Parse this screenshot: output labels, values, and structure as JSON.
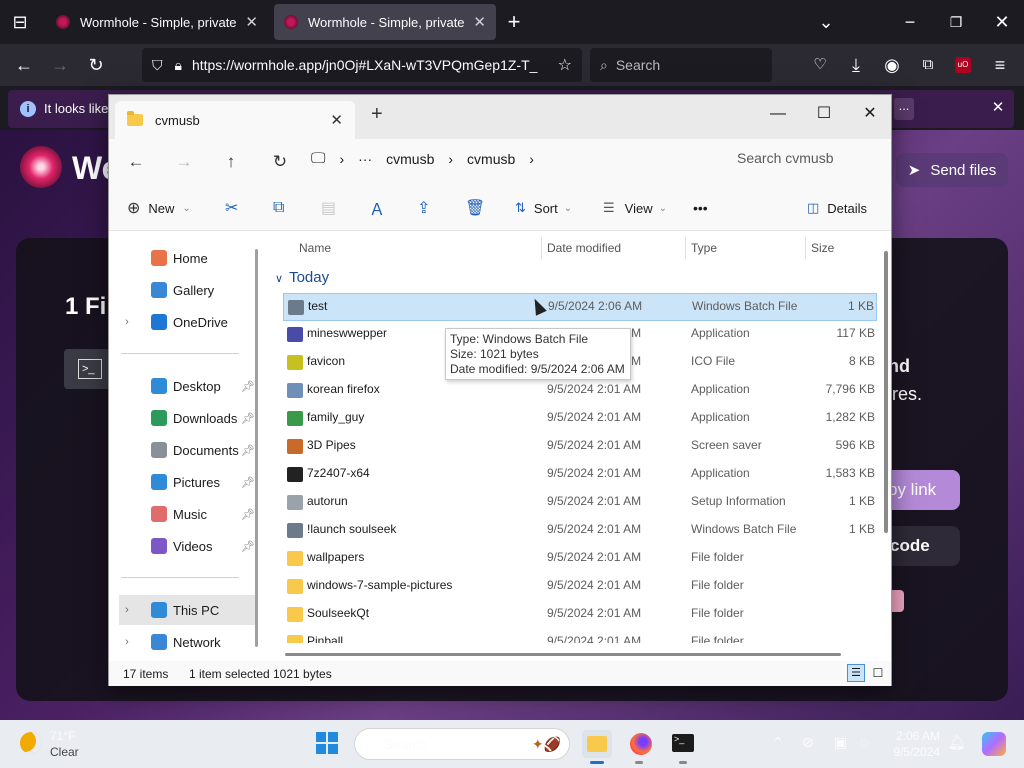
{
  "browser": {
    "tabs": [
      {
        "title": "Wormhole - Simple, private file",
        "active": false
      },
      {
        "title": "Wormhole - Simple, private file",
        "active": true
      }
    ],
    "url": "https://wormhole.app/jn0Oj#LXaN-wT3VPQmGep1Z-T_",
    "search_placeholder": "Search",
    "notification": "It looks like",
    "notification_more": "..."
  },
  "wormhole": {
    "brand": "We",
    "send_files": "Send files",
    "heading": "1 Fi",
    "right_line1": "nd",
    "right_line2": "ires.",
    "copy_link": "py link",
    "qr_code": "code"
  },
  "explorer": {
    "tab_title": "cvmusb",
    "new_tab": "+",
    "breadcrumb": [
      "cvmusb",
      "cvmusb"
    ],
    "more_crumbs": "···",
    "search_placeholder": "Search cvmusb",
    "commands": {
      "new": "New",
      "sort": "Sort",
      "view": "View",
      "more": "•••",
      "details": "Details"
    },
    "sidebar": [
      {
        "label": "Home",
        "color": "#e8734a",
        "pinned": false,
        "chevron": false
      },
      {
        "label": "Gallery",
        "color": "#3a87d6",
        "pinned": false,
        "chevron": false
      },
      {
        "label": "OneDrive",
        "color": "#1f77d4",
        "pinned": false,
        "chevron": true
      },
      {
        "label": "Desktop",
        "color": "#2f8ad8",
        "pinned": true,
        "chevron": false
      },
      {
        "label": "Downloads",
        "color": "#2c9a5b",
        "pinned": true,
        "chevron": false
      },
      {
        "label": "Documents",
        "color": "#8a8f99",
        "pinned": true,
        "chevron": false
      },
      {
        "label": "Pictures",
        "color": "#2f8ad8",
        "pinned": true,
        "chevron": false
      },
      {
        "label": "Music",
        "color": "#e06d6d",
        "pinned": true,
        "chevron": false
      },
      {
        "label": "Videos",
        "color": "#7d57c7",
        "pinned": true,
        "chevron": false
      },
      {
        "label": "This PC",
        "color": "#2f8ad8",
        "pinned": false,
        "chevron": true
      },
      {
        "label": "Network",
        "color": "#3a87d6",
        "pinned": false,
        "chevron": true
      }
    ],
    "columns": [
      "Name",
      "Date modified",
      "Type",
      "Size"
    ],
    "group": "Today",
    "files": [
      {
        "name": "test",
        "date": "9/5/2024 2:06 AM",
        "type": "Windows Batch File",
        "size": "1 KB",
        "icon": "#6b7b8c"
      },
      {
        "name": "mineswwepper",
        "date": "9/5/2024 2:01 AM",
        "type": "Application",
        "size": "117 KB",
        "icon": "#4a4aa8"
      },
      {
        "name": "favicon",
        "date": "9/5/2024 2:01 AM",
        "type": "ICO File",
        "size": "8 KB",
        "icon": "#c8c020"
      },
      {
        "name": "korean firefox",
        "date": "9/5/2024 2:01 AM",
        "type": "Application",
        "size": "7,796 KB",
        "icon": "#6f8fb8"
      },
      {
        "name": "family_guy",
        "date": "9/5/2024 2:01 AM",
        "type": "Application",
        "size": "1,282 KB",
        "icon": "#3a9a4a"
      },
      {
        "name": "3D Pipes",
        "date": "9/5/2024 2:01 AM",
        "type": "Screen saver",
        "size": "596 KB",
        "icon": "#c86a2a"
      },
      {
        "name": "7z2407-x64",
        "date": "9/5/2024 2:01 AM",
        "type": "Application",
        "size": "1,583 KB",
        "icon": "#222222"
      },
      {
        "name": "autorun",
        "date": "9/5/2024 2:01 AM",
        "type": "Setup Information",
        "size": "1 KB",
        "icon": "#9aa2aa"
      },
      {
        "name": "!launch soulseek",
        "date": "9/5/2024 2:01 AM",
        "type": "Windows Batch File",
        "size": "1 KB",
        "icon": "#6b7b8c"
      },
      {
        "name": "wallpapers",
        "date": "9/5/2024 2:01 AM",
        "type": "File folder",
        "size": "",
        "icon": "#f8c94a"
      },
      {
        "name": "windows-7-sample-pictures",
        "date": "9/5/2024 2:01 AM",
        "type": "File folder",
        "size": "",
        "icon": "#f8c94a"
      },
      {
        "name": "SoulseekQt",
        "date": "9/5/2024 2:01 AM",
        "type": "File folder",
        "size": "",
        "icon": "#f8c94a"
      },
      {
        "name": "Pinball",
        "date": "9/5/2024 2:01 AM",
        "type": "File folder",
        "size": "",
        "icon": "#f8c94a"
      }
    ],
    "selected_index": 0,
    "tooltip": {
      "type": "Type: Windows Batch File",
      "size": "Size: 1021 bytes",
      "date": "Date modified: 9/5/2024 2:06 AM"
    },
    "status": {
      "items": "17 items",
      "selected": "1 item selected",
      "bytes": "1021 bytes"
    }
  },
  "taskbar": {
    "weather_temp": "71°F",
    "weather_desc": "Clear",
    "search": "Search",
    "time": "2:06 AM",
    "date": "9/5/2024"
  }
}
